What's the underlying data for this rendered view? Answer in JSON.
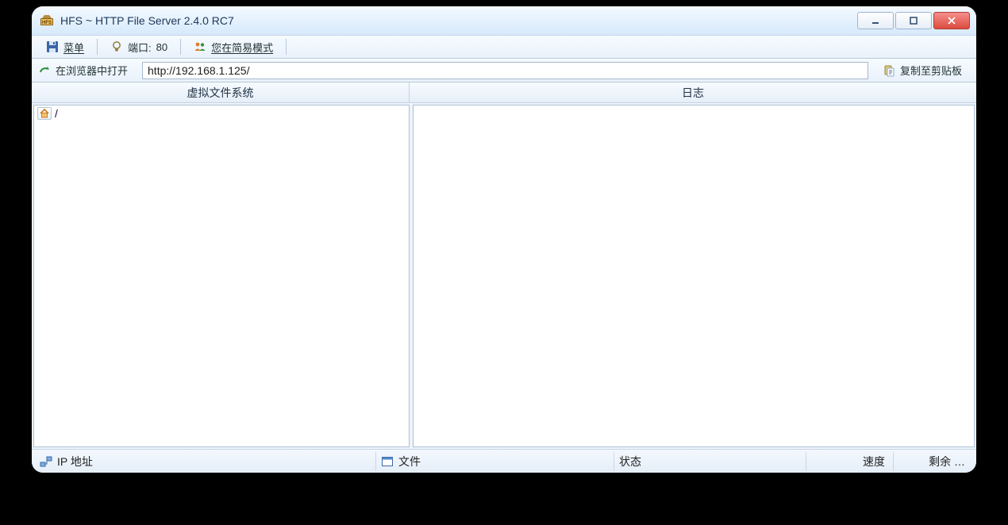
{
  "window": {
    "title": "HFS ~ HTTP File Server 2.4.0 RC7"
  },
  "toolbar": {
    "menu": "菜单",
    "port_label": "端口:",
    "port_value": "80",
    "mode_label": "您在简易模式"
  },
  "urlbar": {
    "open_in_browser": "在浏览器中打开",
    "url": "http://192.168.1.125/",
    "copy_clipboard": "复制至剪贴板"
  },
  "panels": {
    "vfs_header": "虚拟文件系统",
    "log_header": "日志"
  },
  "tree": {
    "root_label": "/"
  },
  "statusbar": {
    "ip_address": "IP 地址",
    "file": "文件",
    "status": "状态",
    "speed": "速度",
    "remaining": "剩余 …"
  }
}
